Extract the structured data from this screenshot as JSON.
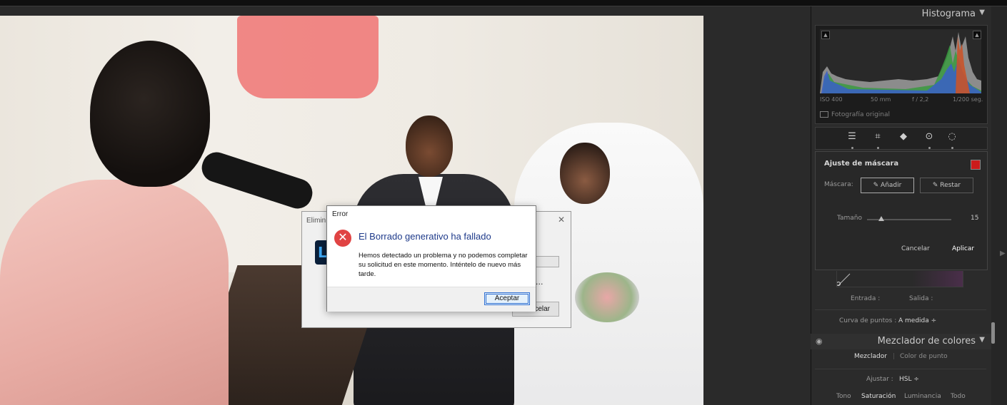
{
  "panel": {
    "histogram": {
      "title": "Histograma",
      "iso": "ISO 400",
      "focal": "50 mm",
      "aperture": "f / 2,2",
      "shutter": "1/200 seg.",
      "original_label": "Fotografía original"
    },
    "mask": {
      "title": "Ajuste de máscara",
      "mask_label": "Máscara:",
      "add_label": "Añadir",
      "subtract_label": "Restar",
      "size_label": "Tamaño",
      "size_value": "15",
      "size_fraction": 0.15,
      "cancel_label": "Cancelar",
      "apply_label": "Aplicar"
    },
    "curve": {
      "input_label": "Entrada :",
      "output_label": "Salida :",
      "points_label": "Curva de puntos :",
      "points_value": "A medida ÷"
    },
    "mixer": {
      "title": "Mezclador de colores",
      "tab_mixer": "Mezclador",
      "tab_point": "Color de punto",
      "adjust_label": "Ajustar :",
      "adjust_value": "HSL ÷",
      "subtabs": [
        "Tono",
        "Saturación",
        "Luminancia",
        "Todo"
      ]
    }
  },
  "back_dialog": {
    "caption": "Elimin",
    "logo": "L",
    "dots": "...",
    "cancel_label": "Cancelar"
  },
  "error_dialog": {
    "caption": "Error",
    "title": "El Borrado generativo ha fallado",
    "message": "Hemos detectado un problema y no podemos completar su solicitud en este momento. Inténtelo de nuevo más tarde.",
    "ok_label": "Aceptar"
  },
  "colors": {
    "mask_swatch": "#cc1b1b",
    "error_icon": "#e04343",
    "title_blue": "#1e3a8a"
  }
}
